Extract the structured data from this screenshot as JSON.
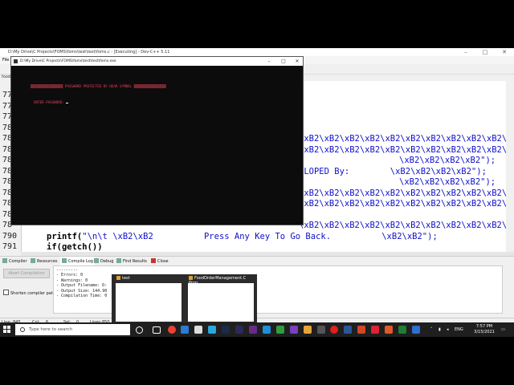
{
  "ide": {
    "title": "D:\\My Drive\\C Projects\\FOMS\\foms\\test\\test\\foms.c - [Executing] - Dev-C++ 5.11",
    "menu_first": "File",
    "file_tab": "food",
    "line_numbers": [
      "77",
      "77",
      "77",
      "78",
      "78",
      "78",
      "78",
      "78",
      "78",
      "78",
      "78",
      "78",
      "78",
      "790",
      "791"
    ],
    "code_rows": [
      "\\xB2\\xB2\\xB2\\xB2\\xB2\\xB2\\xB2\\xB2\\xB2\\xB2\\xB2\\xB2\\xB2\\xB2",
      "\\xB2\\xB2\\xB2\\xB2\\xB2\\xB2\\xB2\\xB2\\xB2\\xB2\\xB2\\xB2\\xB2\\xB2",
      "\\xB2\\xB2\\xB2\\xB2\");",
      "ELOPED By:        \\xB2\\xB2\\xB2\\xB2\");",
      "\\xB2\\xB2\\xB2\\xB2\");",
      "\\xB2\\xB2\\xB2\\xB2\\xB2\\xB2\\xB2\\xB2\\xB2\\xB2\\xB2\\xB2\\xB2\\xB2",
      "\\xB2\\xB2\\xB2\\xB2\\xB2\\xB2\\xB2\\xB2\\xB2\\xB2\\xB2\\xB2\\xB2\\xB2",
      "\\xB2\\xB2\\xB2\\xB2\\xB2\\xB2\\xB2\\xB2\\xB2\\xB2\\xB2\\xB2\\xB2\\xB2"
    ],
    "line_790_fn": "printf(",
    "line_790_str": "\"\\n\\t \\xB2\\xB2          Press Any Key To Go Back.          \\xB2\\xB2\");",
    "line_791": "if(getch())"
  },
  "bottom_tabs": [
    "Compiler",
    "Resources",
    "Compile Log",
    "Debug",
    "Find Results",
    "Close"
  ],
  "log_panel": {
    "abort_label": "Abort Compilation",
    "shorten_label": "Shorten compiler paths",
    "lines": [
      "---------",
      "- Errors: 0",
      "- Warnings: 0",
      "- Output Filename: D:",
      "- Output Size: 144.90",
      "- Compilation Time: 0"
    ]
  },
  "status_bar": {
    "line": "Line:",
    "line_val": "845",
    "col": "Col:",
    "col_val": "6",
    "sel": "Sel:",
    "sel_val": "0",
    "lines": "Lines:",
    "lines_val": "850"
  },
  "console": {
    "title": "D:\\My Drive\\C Projects\\FOMS\\foms\\test\\test\\foms.exe",
    "banner": "▒▒▒▒▒▒▒▒▒▒▒▒▒▒▒▒ PASSWORD PROTECTED BY HEAR SYMBOL ▒▒▒▒▒▒▒▒▒▒▒▒▒▒▒▒",
    "prompt": "ENTER PASSWORD:"
  },
  "thumbnails": [
    {
      "title": "test"
    },
    {
      "title": "FoodOrderManagement.C Prog..."
    }
  ],
  "taskbar": {
    "search_placeholder": "Type here to search",
    "lang": "ENG",
    "time": "7:57 PM",
    "date": "3/15/2021"
  },
  "colors": {
    "code_blue": "#1010c8",
    "console_text": "#e0405a",
    "taskbar": "#1f1f1f"
  }
}
